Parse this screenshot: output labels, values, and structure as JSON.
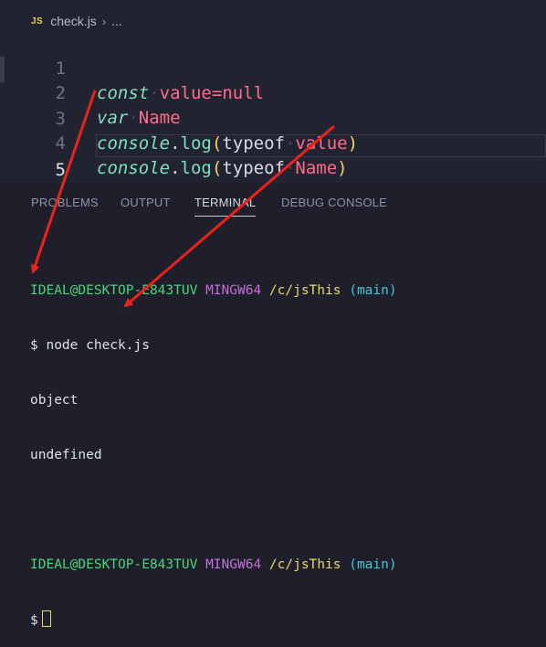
{
  "breadcrumb": {
    "file_badge": "JS",
    "file_name": "check.js",
    "more": "..."
  },
  "editor": {
    "lines": [
      {
        "number": "1",
        "tokens": [
          "const",
          "value",
          "=",
          "null"
        ]
      },
      {
        "number": "2",
        "tokens": [
          "var",
          "Name"
        ]
      },
      {
        "number": "3",
        "tokens": [
          "console",
          ".",
          "log",
          "(",
          "typeof",
          "value",
          ")"
        ]
      },
      {
        "number": "4",
        "tokens": [
          "console",
          ".",
          "log",
          "(",
          "typeof",
          "Name",
          ")"
        ]
      },
      {
        "number": "5",
        "tokens": []
      }
    ]
  },
  "panel": {
    "tabs": [
      "PROBLEMS",
      "OUTPUT",
      "TERMINAL",
      "DEBUG CONSOLE"
    ],
    "active_tab": "TERMINAL"
  },
  "terminal": {
    "prompt1": {
      "user": "IDEAL@DESKTOP-E843TUV",
      "env": "MINGW64",
      "path": "/c/jsThis",
      "branch": "(main)"
    },
    "command": {
      "symbol": "$",
      "text": "node check.js"
    },
    "output": [
      "object",
      "undefined"
    ],
    "prompt2": {
      "user": "IDEAL@DESKTOP-E843TUV",
      "env": "MINGW64",
      "path": "/c/jsThis",
      "branch": "(main)"
    },
    "input_symbol": "$"
  },
  "colors": {
    "annotation_arrow": "#e8231b",
    "editor_bg": "#222331",
    "terminal_bg": "#1e1f2b"
  },
  "icons": [
    "js-file-icon",
    "chevron-right-icon",
    "terminal-cursor-icon",
    "red-arrow-annotation"
  ]
}
